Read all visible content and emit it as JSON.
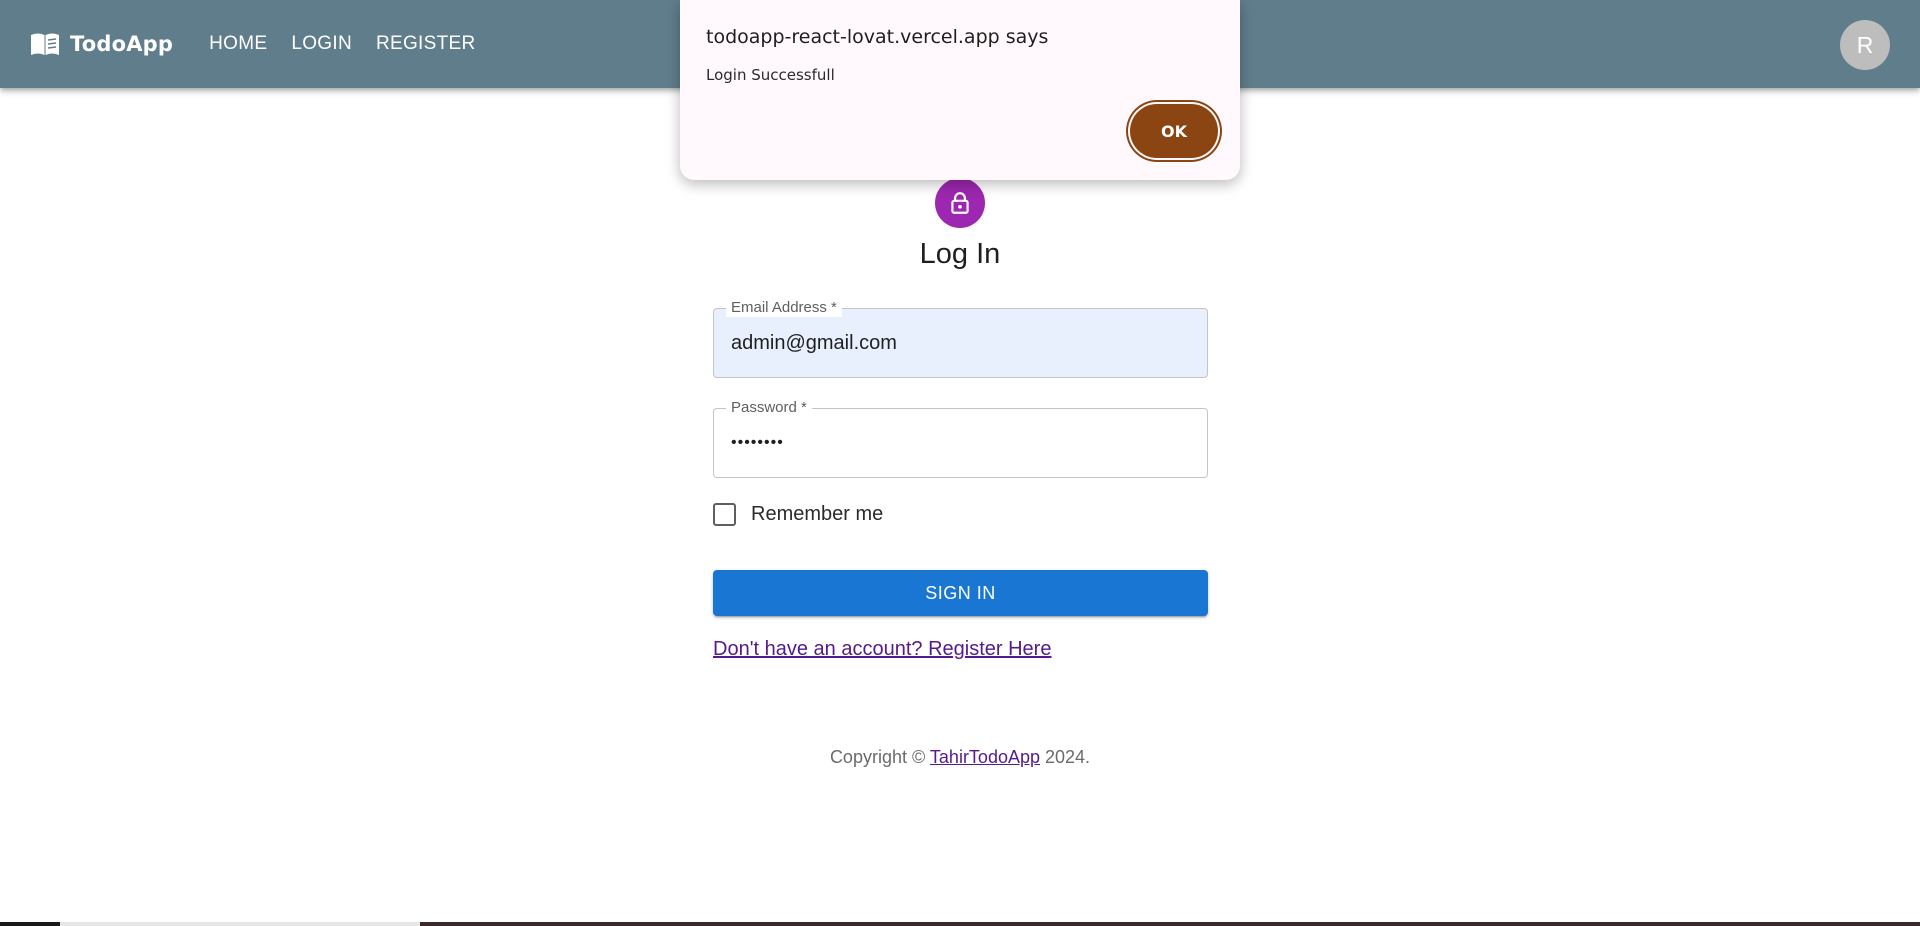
{
  "header": {
    "brand": "TodoApp",
    "nav": [
      "HOME",
      "LOGIN",
      "REGISTER"
    ],
    "avatar_initial": "R",
    "background_color": "#607d8b"
  },
  "form": {
    "title": "Log In",
    "email_label": "Email Address *",
    "email_value": "admin@gmail.com",
    "password_label": "Password *",
    "password_value": "••••••••",
    "remember_label": "Remember me",
    "remember_checked": false,
    "submit_label": "SIGN IN",
    "register_link": "Don't have an account? Register Here",
    "lock_color": "#9c27b0",
    "submit_color": "#1976d2"
  },
  "footer": {
    "prefix": "Copyright © ",
    "link": "TahirTodoApp",
    "suffix": " 2024."
  },
  "dialog": {
    "title": "todoapp-react-lovat.vercel.app says",
    "message": "Login Successfull",
    "ok_label": "OK",
    "ok_color": "#8b4513"
  },
  "icons": {
    "brand": "book-icon",
    "form": "lock-icon"
  }
}
